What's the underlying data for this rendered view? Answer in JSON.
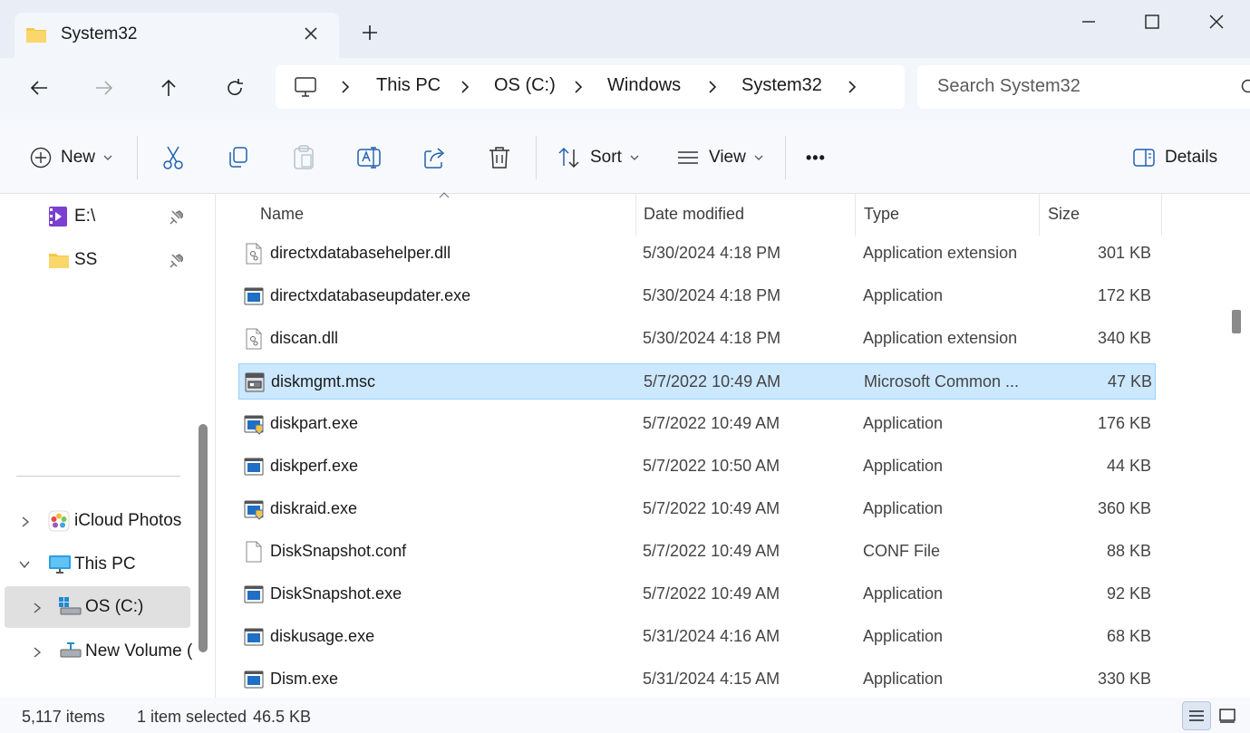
{
  "window": {
    "tab_title": "System32",
    "new_tab_symbol": "+",
    "minimize_symbol": "—",
    "maximize_symbol": "☐",
    "close_symbol": "✕"
  },
  "address": {
    "breadcrumbs": [
      "This PC",
      "OS (C:)",
      "Windows",
      "System32"
    ],
    "search_placeholder": "Search System32"
  },
  "toolbar": {
    "new_label": "New",
    "sort_label": "Sort",
    "view_label": "View",
    "more_label": "•••",
    "details_label": "Details"
  },
  "nav": {
    "items": [
      {
        "label": "E:\\",
        "icon": "video-folder-icon"
      },
      {
        "label": "SS",
        "icon": "folder-icon"
      },
      {
        "label": "iCloud Photos",
        "icon": "icloud-photos-icon"
      },
      {
        "label": "This PC",
        "icon": "computer-icon"
      },
      {
        "label": "OS (C:)",
        "icon": "drive-icon"
      },
      {
        "label": "New Volume (E",
        "icon": "network-drive-icon"
      }
    ]
  },
  "columns": {
    "name": "Name",
    "date": "Date modified",
    "type": "Type",
    "size": "Size"
  },
  "files": [
    {
      "name": "directxdatabasehelper.dll",
      "date": "5/30/2024 4:18 PM",
      "type": "Application extension",
      "size": "301 KB",
      "icon": "dll-icon"
    },
    {
      "name": "directxdatabaseupdater.exe",
      "date": "5/30/2024 4:18 PM",
      "type": "Application",
      "size": "172 KB",
      "icon": "exe-icon"
    },
    {
      "name": "discan.dll",
      "date": "5/30/2024 4:18 PM",
      "type": "Application extension",
      "size": "340 KB",
      "icon": "dll-icon"
    },
    {
      "name": "diskmgmt.msc",
      "date": "5/7/2022 10:49 AM",
      "type": "Microsoft Common ...",
      "size": "47 KB",
      "icon": "msc-icon"
    },
    {
      "name": "diskpart.exe",
      "date": "5/7/2022 10:49 AM",
      "type": "Application",
      "size": "176 KB",
      "icon": "exe-shield-icon"
    },
    {
      "name": "diskperf.exe",
      "date": "5/7/2022 10:50 AM",
      "type": "Application",
      "size": "44 KB",
      "icon": "exe-icon"
    },
    {
      "name": "diskraid.exe",
      "date": "5/7/2022 10:49 AM",
      "type": "Application",
      "size": "360 KB",
      "icon": "exe-shield-icon"
    },
    {
      "name": "DiskSnapshot.conf",
      "date": "5/7/2022 10:49 AM",
      "type": "CONF File",
      "size": "88 KB",
      "icon": "blank-file-icon"
    },
    {
      "name": "DiskSnapshot.exe",
      "date": "5/7/2022 10:49 AM",
      "type": "Application",
      "size": "92 KB",
      "icon": "exe-icon"
    },
    {
      "name": "diskusage.exe",
      "date": "5/31/2024 4:16 AM",
      "type": "Application",
      "size": "68 KB",
      "icon": "exe-icon"
    },
    {
      "name": "Dism.exe",
      "date": "5/31/2024 4:15 AM",
      "type": "Application",
      "size": "330 KB",
      "icon": "exe-icon"
    }
  ],
  "status": {
    "item_count": "5,117 items",
    "selection": "1 item selected",
    "selection_size": "46.5 KB"
  },
  "colors": {
    "accent": "#0067c0",
    "selection_bg": "#cce8ff",
    "selection_border": "#99d1ff",
    "folder_yellow": "#f8c84a"
  }
}
